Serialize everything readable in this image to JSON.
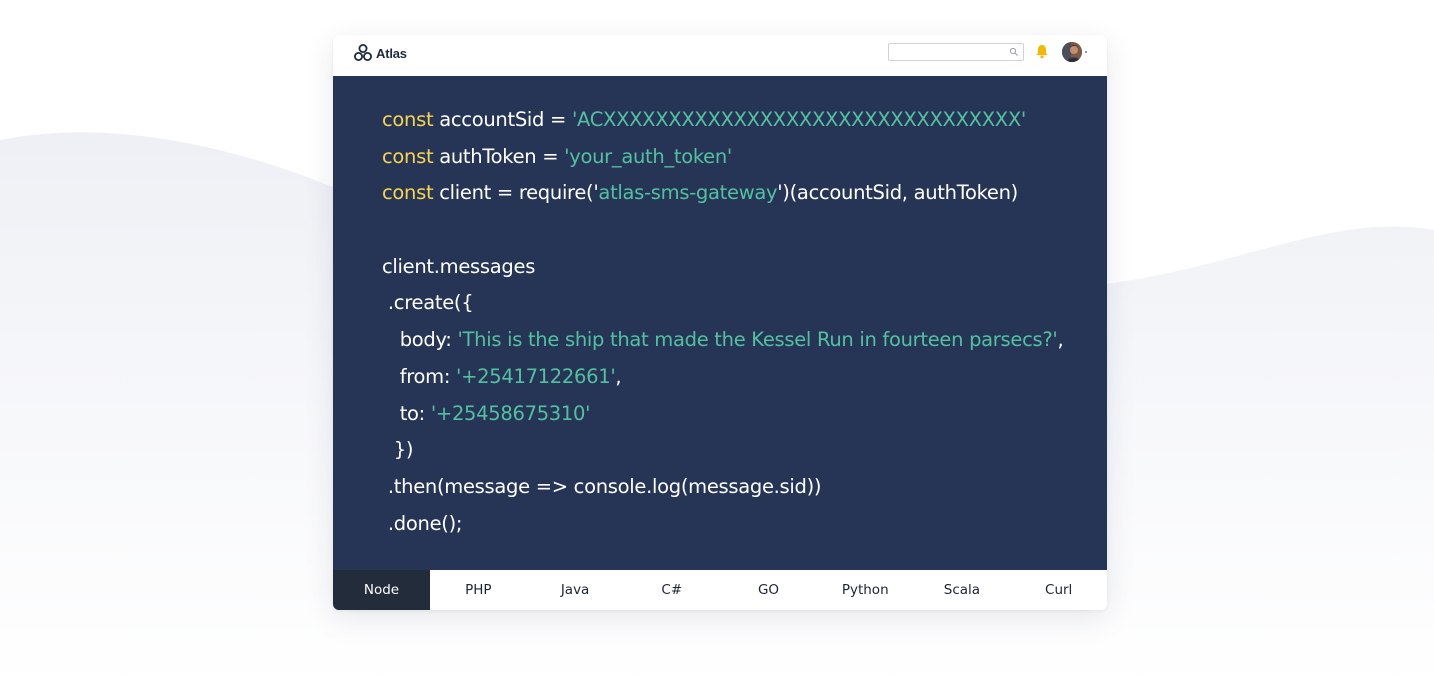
{
  "brand": {
    "name": "Atlas"
  },
  "search": {
    "placeholder": ""
  },
  "icons": {
    "logo": "atlas-logo-icon",
    "search": "search-icon",
    "notifications": "bell-icon",
    "user": "avatar"
  },
  "colors": {
    "code_background": "#263556",
    "keyword": "#f8d450",
    "string": "#53c1a0",
    "code_text": "#ffffff",
    "active_tab": "#222c3b",
    "bell": "#f5b800"
  },
  "code": {
    "lines": [
      [
        {
          "t": "const",
          "k": "kw"
        },
        {
          "t": " accountSid = ",
          "k": "txt"
        },
        {
          "t": "'ACXXXXXXXXXXXXXXXXXXXXXXXXXXXXXXXX'",
          "k": "str"
        }
      ],
      [
        {
          "t": "const",
          "k": "kw"
        },
        {
          "t": " authToken = ",
          "k": "txt"
        },
        {
          "t": "'your_auth_token'",
          "k": "str"
        }
      ],
      [
        {
          "t": "const",
          "k": "kw"
        },
        {
          "t": " client = require('",
          "k": "txt"
        },
        {
          "t": "atlas-sms-gateway",
          "k": "str"
        },
        {
          "t": "')(accountSid, authToken)",
          "k": "txt"
        }
      ],
      [],
      [
        {
          "t": "client.messages",
          "k": "txt"
        }
      ],
      [
        {
          "t": " .create({",
          "k": "txt"
        }
      ],
      [
        {
          "t": "   body: ",
          "k": "txt"
        },
        {
          "t": "'This is the ship that made the Kessel Run in fourteen parsecs?'",
          "k": "str"
        },
        {
          "t": ",",
          "k": "txt"
        }
      ],
      [
        {
          "t": "   from: ",
          "k": "txt"
        },
        {
          "t": "'+25417122661'",
          "k": "str"
        },
        {
          "t": ",",
          "k": "txt"
        }
      ],
      [
        {
          "t": "   to: ",
          "k": "txt"
        },
        {
          "t": "'+25458675310'",
          "k": "str"
        }
      ],
      [
        {
          "t": "  })",
          "k": "txt"
        }
      ],
      [
        {
          "t": " .then(message => console.log(message.sid))",
          "k": "txt"
        }
      ],
      [
        {
          "t": " .done();",
          "k": "txt"
        }
      ]
    ]
  },
  "tabs": [
    {
      "label": "Node",
      "active": true
    },
    {
      "label": "PHP",
      "active": false
    },
    {
      "label": "Java",
      "active": false
    },
    {
      "label": "C#",
      "active": false
    },
    {
      "label": "GO",
      "active": false
    },
    {
      "label": "Python",
      "active": false
    },
    {
      "label": "Scala",
      "active": false
    },
    {
      "label": "Curl",
      "active": false
    }
  ]
}
